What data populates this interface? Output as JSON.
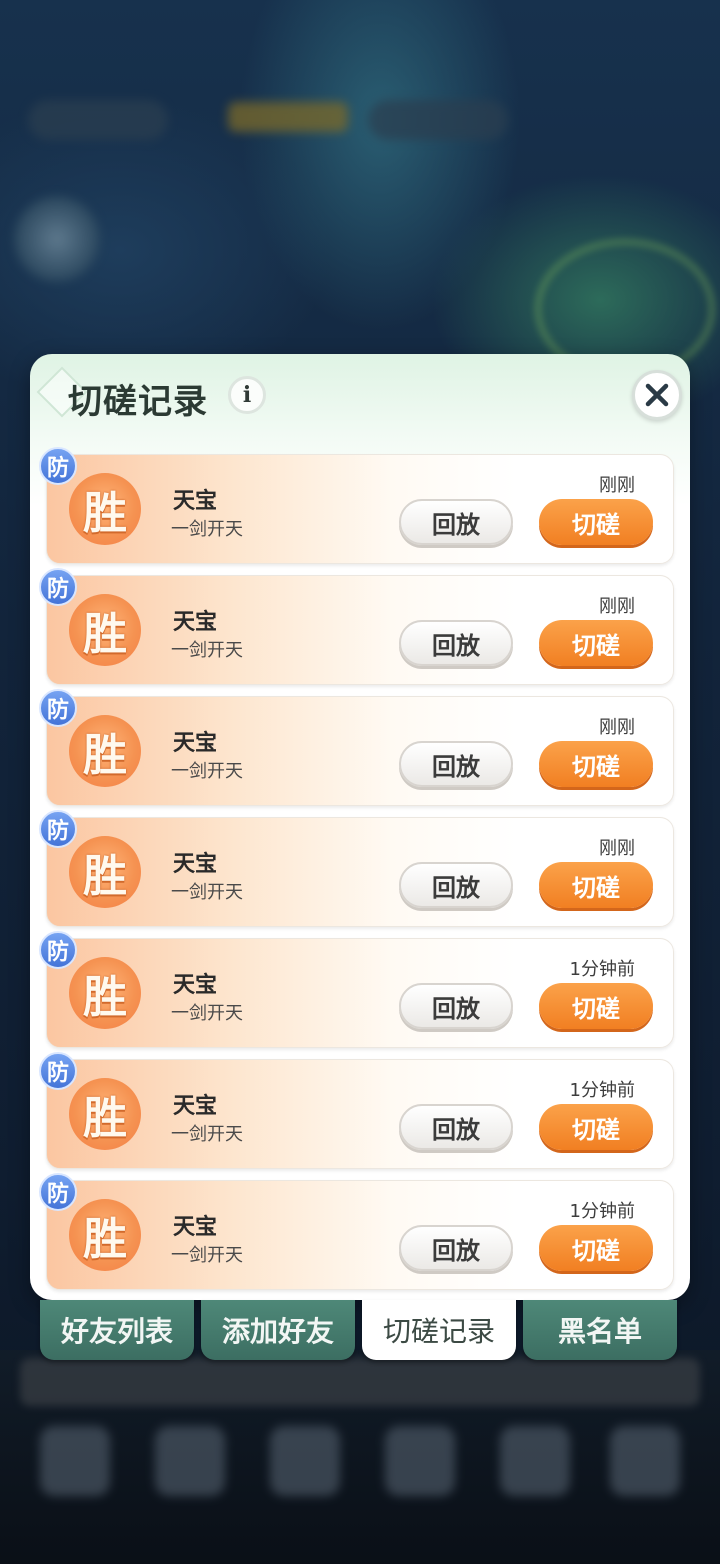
{
  "dialog": {
    "title": "切磋记录",
    "info_icon_glyph": "i",
    "close_icon": "close-icon"
  },
  "records": [
    {
      "badge": "防",
      "result": "胜",
      "name": "天宝",
      "subtitle": "一剑开天",
      "time": "刚刚",
      "replay_label": "回放",
      "spar_label": "切磋"
    },
    {
      "badge": "防",
      "result": "胜",
      "name": "天宝",
      "subtitle": "一剑开天",
      "time": "刚刚",
      "replay_label": "回放",
      "spar_label": "切磋"
    },
    {
      "badge": "防",
      "result": "胜",
      "name": "天宝",
      "subtitle": "一剑开天",
      "time": "刚刚",
      "replay_label": "回放",
      "spar_label": "切磋"
    },
    {
      "badge": "防",
      "result": "胜",
      "name": "天宝",
      "subtitle": "一剑开天",
      "time": "刚刚",
      "replay_label": "回放",
      "spar_label": "切磋"
    },
    {
      "badge": "防",
      "result": "胜",
      "name": "天宝",
      "subtitle": "一剑开天",
      "time": "1分钟前",
      "replay_label": "回放",
      "spar_label": "切磋"
    },
    {
      "badge": "防",
      "result": "胜",
      "name": "天宝",
      "subtitle": "一剑开天",
      "time": "1分钟前",
      "replay_label": "回放",
      "spar_label": "切磋"
    },
    {
      "badge": "防",
      "result": "胜",
      "name": "天宝",
      "subtitle": "一剑开天",
      "time": "1分钟前",
      "replay_label": "回放",
      "spar_label": "切磋"
    }
  ],
  "tabs": [
    {
      "label": "好友列表",
      "active": false
    },
    {
      "label": "添加好友",
      "active": false
    },
    {
      "label": "切磋记录",
      "active": true
    },
    {
      "label": "黑名单",
      "active": false
    }
  ],
  "colors": {
    "accent_orange": "#f17f22",
    "defense_badge_blue": "#4474d8",
    "tab_green": "#3c6e62"
  }
}
